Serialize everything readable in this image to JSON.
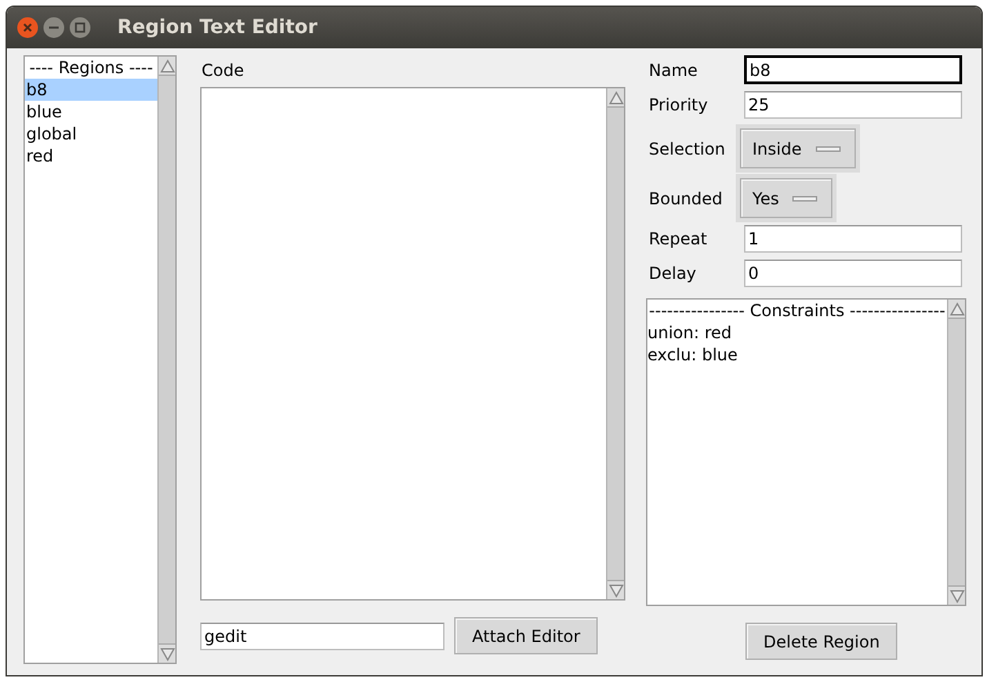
{
  "window": {
    "title": "Region Text Editor"
  },
  "regions": {
    "header": "---- Regions ----",
    "items": [
      {
        "label": "b8",
        "selected": true
      },
      {
        "label": "blue",
        "selected": false
      },
      {
        "label": "global",
        "selected": false
      },
      {
        "label": "red",
        "selected": false
      }
    ]
  },
  "code": {
    "label": "Code",
    "editor_command": "gedit",
    "attach_button": "Attach Editor"
  },
  "properties": [
    {
      "kind": "entry",
      "label": "Name",
      "value": "b8",
      "focused": true
    },
    {
      "kind": "entry",
      "label": "Priority",
      "value": "25",
      "focused": false
    },
    {
      "kind": "menu",
      "label": "Selection",
      "value": "Inside"
    },
    {
      "kind": "menu",
      "label": "Bounded",
      "value": "Yes"
    },
    {
      "kind": "entry",
      "label": "Repeat",
      "value": "1",
      "focused": false
    },
    {
      "kind": "entry",
      "label": "Delay",
      "value": "0",
      "focused": false
    }
  ],
  "constraints": {
    "header": "---------------- Constraints ----------------",
    "items": [
      "union: red",
      "exclu: blue"
    ]
  },
  "delete_button": "Delete Region"
}
